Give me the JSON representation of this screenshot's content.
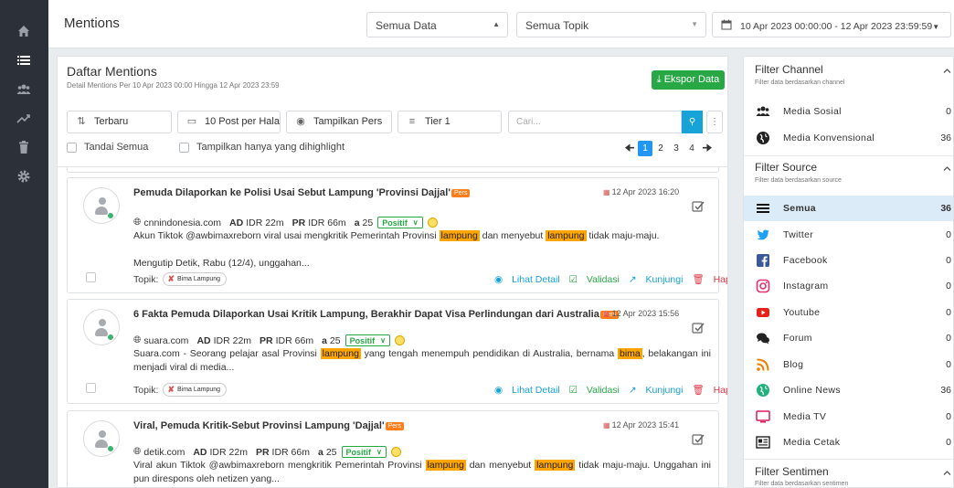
{
  "header": {
    "title": "Mentions",
    "data_select": "Semua Data",
    "topic_select": "Semua Topik",
    "date_range": "10 Apr 2023 00:00:00 - 12 Apr 2023 23:59:59"
  },
  "main": {
    "title": "Daftar Mentions",
    "subtitle": "Detail Mentions Per 10 Apr 2023 00:00 Hingga 12 Apr 2023 23:59",
    "export_label": "Ekspor Data",
    "toolbar": {
      "sort": "Terbaru",
      "per_page": "10 Post per Halaman",
      "view": "Tampilkan Pers",
      "tier": "Tier 1",
      "search_placeholder": "Cari..."
    },
    "select_all": "Tandai Semua",
    "highlight_only": "Tampilkan hanya yang dihighlight",
    "pages": [
      "1",
      "2",
      "3",
      "4"
    ]
  },
  "mentions": [
    {
      "title": "Pemuda Dilaporkan ke Polisi Usai Sebut Lampung 'Provinsi Dajjal'",
      "badge": "Pers",
      "date": "12 Apr 2023 16:20",
      "source": "cnnindonesia.com",
      "ad_label": "AD",
      "ad": "IDR 22m",
      "pr_label": "PR",
      "pr": "IDR 66m",
      "a_label": "a",
      "a": "25",
      "sentiment": "Positif",
      "snippet": [
        {
          "t": "Akun Tiktok @awbimaxreborn viral usai mengkritik Pemerintah Provinsi "
        },
        {
          "t": "lampung",
          "hl": true
        },
        {
          "t": " dan menyebut "
        },
        {
          "t": "lampung",
          "hl": true
        },
        {
          "t": " tidak maju-maju."
        }
      ],
      "snippet2": "Mengutip Detik, Rabu (12/4), unggahan...",
      "topic_label": "Topik:",
      "topic": "Bima Lampung",
      "actions": {
        "detail": "Lihat Detail",
        "validate": "Validasi",
        "visit": "Kunjungi",
        "delete": "Hapus"
      }
    },
    {
      "title": "6 Fakta Pemuda Dilaporkan Usai Kritik Lampung, Berakhir Dapat Visa Perlindungan dari Australia",
      "badge": "Pers",
      "date": "12 Apr 2023 15:56",
      "source": "suara.com",
      "ad_label": "AD",
      "ad": "IDR 22m",
      "pr_label": "PR",
      "pr": "IDR 66m",
      "a_label": "a",
      "a": "25",
      "sentiment": "Positif",
      "snippet": [
        {
          "t": "Suara.com - Seorang pelajar asal Provinsi "
        },
        {
          "t": "lampung",
          "hl": true
        },
        {
          "t": " yang tengah menempuh pendidikan di Australia, bernama "
        },
        {
          "t": "bima",
          "hl": true
        },
        {
          "t": ", belakangan ini menjadi viral di media..."
        }
      ],
      "snippet2": "",
      "topic_label": "Topik:",
      "topic": "Bima Lampung",
      "actions": {
        "detail": "Lihat Detail",
        "validate": "Validasi",
        "visit": "Kunjungi",
        "delete": "Hapus"
      }
    },
    {
      "title": "Viral, Pemuda Kritik-Sebut Provinsi Lampung 'Dajjal'",
      "badge": "Pers",
      "date": "12 Apr 2023 15:41",
      "source": "detik.com",
      "ad_label": "AD",
      "ad": "IDR 22m",
      "pr_label": "PR",
      "pr": "IDR 66m",
      "a_label": "a",
      "a": "25",
      "sentiment": "Positif",
      "snippet": [
        {
          "t": "Viral akun Tiktok @awbimaxreborn mengkritik Pemerintah Provinsi "
        },
        {
          "t": "lampung",
          "hl": true
        },
        {
          "t": " dan menyebut "
        },
        {
          "t": "lampung",
          "hl": true
        },
        {
          "t": " tidak maju-maju. Unggahan ini pun direspons oleh netizen yang..."
        }
      ],
      "snippet2": "",
      "topic_label": "",
      "topic": "",
      "actions": {
        "detail": "",
        "validate": "",
        "visit": "",
        "delete": ""
      }
    }
  ],
  "filters": {
    "channel": {
      "title": "Filter Channel",
      "subtitle": "Filter data berdasarkan channel",
      "items": [
        {
          "label": "Media Sosial",
          "count": "0",
          "icon": "users-icon"
        },
        {
          "label": "Media Konvensional",
          "count": "36",
          "icon": "globe-icon"
        }
      ]
    },
    "source": {
      "title": "Filter Source",
      "subtitle": "Filter data berdasarkan source",
      "items": [
        {
          "label": "Semua",
          "count": "36",
          "icon": "menu-icon",
          "selected": true
        },
        {
          "label": "Twitter",
          "count": "0",
          "icon": "twitter-icon"
        },
        {
          "label": "Facebook",
          "count": "0",
          "icon": "facebook-icon"
        },
        {
          "label": "Instagram",
          "count": "0",
          "icon": "instagram-icon"
        },
        {
          "label": "Youtube",
          "count": "0",
          "icon": "youtube-icon"
        },
        {
          "label": "Forum",
          "count": "0",
          "icon": "forum-icon"
        },
        {
          "label": "Blog",
          "count": "0",
          "icon": "rss-icon"
        },
        {
          "label": "Online News",
          "count": "36",
          "icon": "globe-icon"
        },
        {
          "label": "Media TV",
          "count": "0",
          "icon": "tv-icon"
        },
        {
          "label": "Media Cetak",
          "count": "0",
          "icon": "newspaper-icon"
        }
      ]
    },
    "sentiment": {
      "title": "Filter Sentimen",
      "subtitle": "Filter data berdasarkan sentimen"
    }
  },
  "colors": {
    "sidebar": "#2c3038",
    "export": "#28a745",
    "highlight": "#ffa500",
    "pers_badge": "#ff7d1a",
    "pagination_active": "#2196f3",
    "selected_filter": "#dcebf8"
  }
}
